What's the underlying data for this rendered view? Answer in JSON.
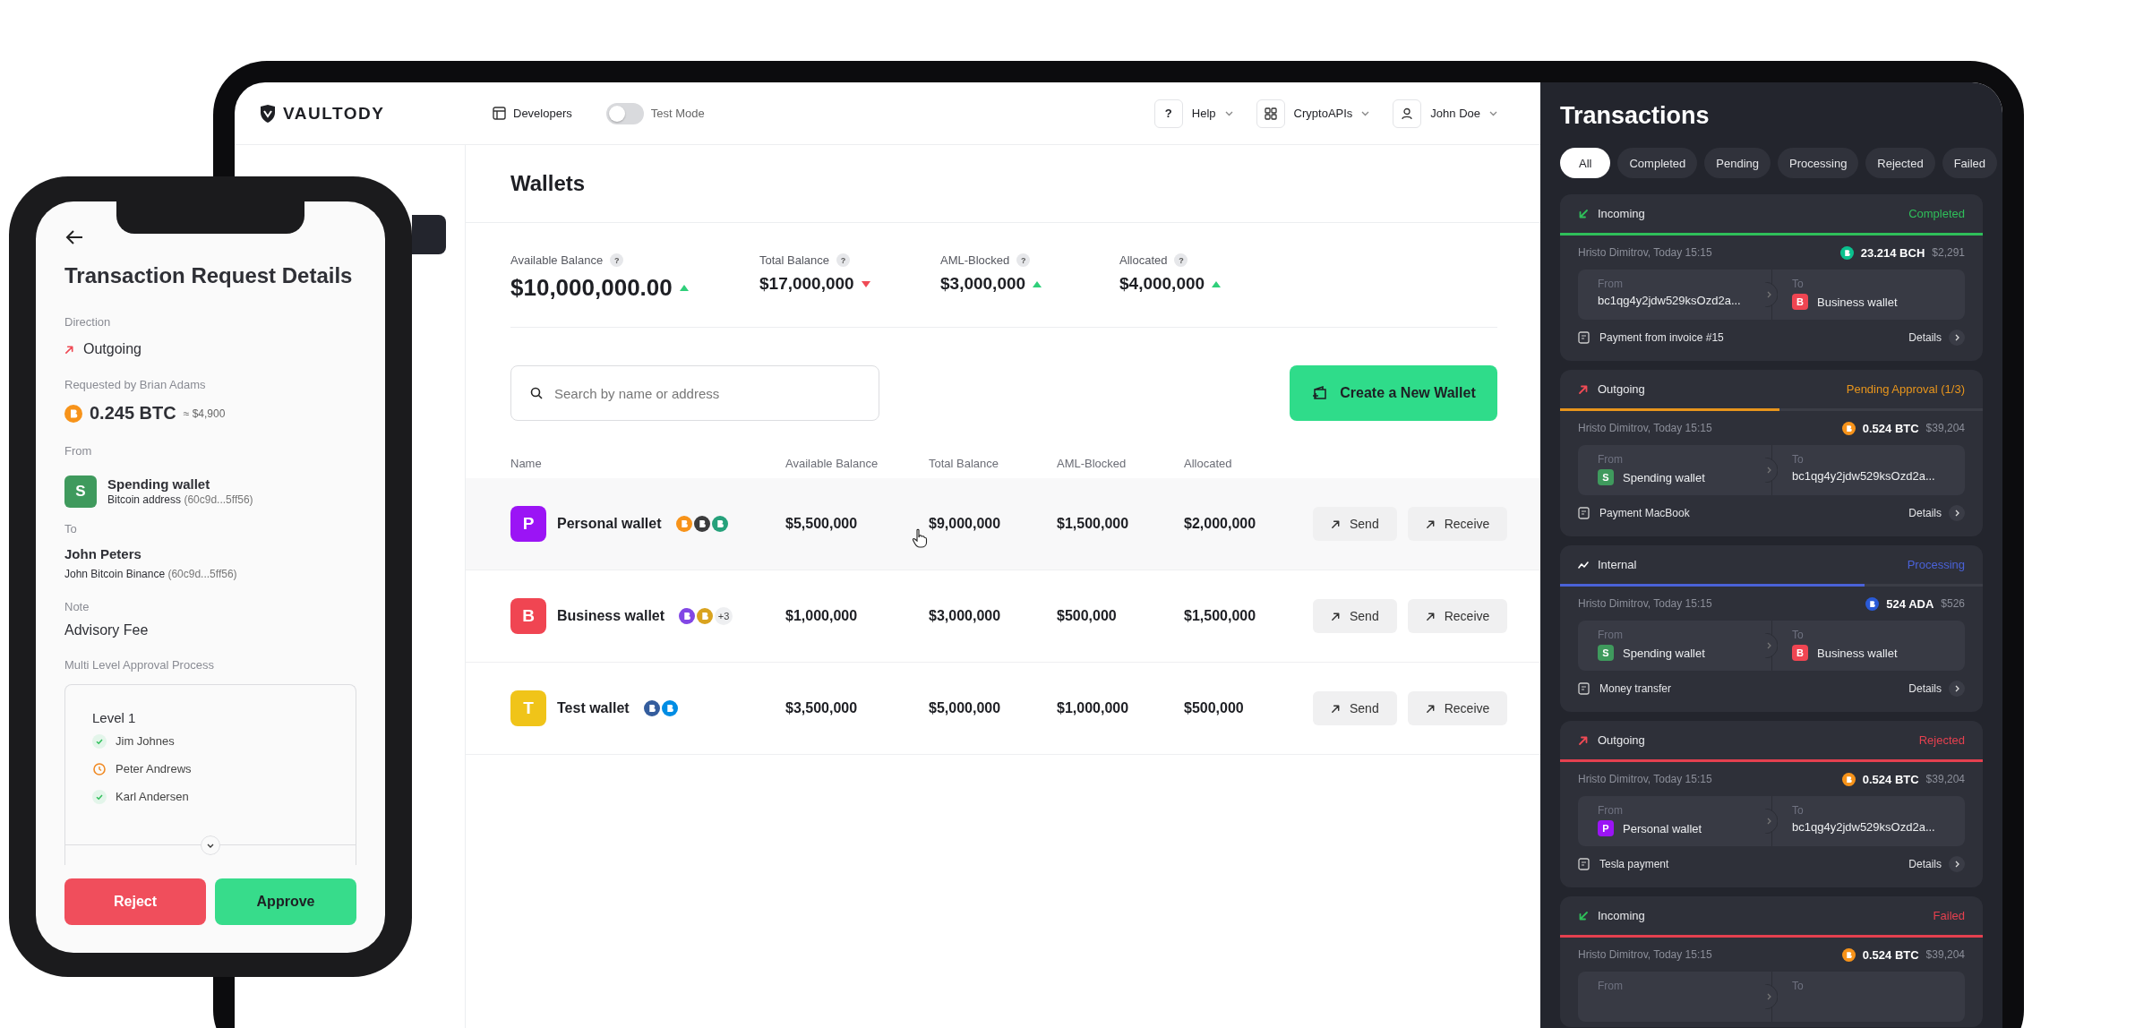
{
  "topbar": {
    "logo": "VAULTODY",
    "developers": "Developers",
    "test_mode": {
      "label": "Test Mode",
      "on": false
    },
    "help": {
      "glyph": "?",
      "label": "Help"
    },
    "apis": {
      "label": "CryptoAPIs"
    },
    "user": {
      "label": "John Doe"
    }
  },
  "sidebar": {
    "items": [
      {
        "selected": true
      }
    ]
  },
  "wallets": {
    "title": "Wallets",
    "balances": [
      {
        "label": "Available Balance",
        "hint": "?",
        "value": "$10,000,000.00",
        "kind": "up"
      },
      {
        "label": "Total Balance",
        "hint": "?",
        "value": "$17,000,000",
        "kind": "down"
      },
      {
        "label": "AML-Blocked",
        "hint": "?",
        "value": "$3,000,000",
        "kind": "up"
      },
      {
        "label": "Allocated",
        "hint": "?",
        "value": "$4,000,000",
        "kind": "up"
      }
    ],
    "search": {
      "placeholder": "Search by name or address"
    },
    "create_button": "Create a New Wallet",
    "columns": [
      "Name",
      "Available Balance",
      "Total Balance",
      "AML-Blocked",
      "Allocated"
    ],
    "rows": [
      {
        "avatar": "P",
        "color": "#9b14f5",
        "name": "Personal wallet",
        "coins": [
          {
            "kind": "btc"
          },
          {
            "kind": "eth"
          },
          {
            "kind": "usdt"
          }
        ],
        "available": "$5,500,000",
        "total": "$9,000,000",
        "aml": "$1,500,000",
        "allocated": "$2,000,000",
        "selected": true,
        "actions": [
          "Send",
          "Receive"
        ]
      },
      {
        "avatar": "B",
        "color": "#f04552",
        "name": "Business wallet",
        "coins": [
          {
            "kind": "matic"
          },
          {
            "kind": "bnb"
          }
        ],
        "more": "+3",
        "available": "$1,000,000",
        "total": "$3,000,000",
        "aml": "$500,000",
        "allocated": "$1,500,000",
        "selected": false,
        "actions": [
          "Send",
          "Receive"
        ]
      },
      {
        "avatar": "T",
        "color": "#f0c419",
        "name": "Test wallet",
        "coins": [
          {
            "kind": "ltc"
          },
          {
            "kind": "dash"
          }
        ],
        "available": "$3,500,000",
        "total": "$5,000,000",
        "aml": "$1,000,000",
        "allocated": "$500,000",
        "selected": false,
        "actions": [
          "Send",
          "Receive"
        ]
      }
    ]
  },
  "transactions": {
    "title": "Transactions",
    "filters": [
      {
        "label": "All",
        "selected": true
      },
      {
        "label": "Completed",
        "selected": false
      },
      {
        "label": "Pending",
        "selected": false
      },
      {
        "label": "Processing",
        "selected": false
      },
      {
        "label": "Rejected",
        "selected": false
      },
      {
        "label": "Failed",
        "selected": false
      }
    ],
    "cards": [
      {
        "kind": "incoming",
        "direction": "Incoming",
        "status": "Completed",
        "color": "#2fbf5a",
        "level": 1,
        "who": "Hristo Dimitrov, Today 15:15",
        "coin": {
          "kind": "bch"
        },
        "amount": "23.214 BCH",
        "usd": "$2,291",
        "from": {
          "label": "From",
          "kind": "address",
          "address": "bc1qg4y2jdw529ksOzd2a..."
        },
        "to": {
          "label": "To",
          "kind": "wallet",
          "avatar": "B",
          "color": "#f04552",
          "name": "Business wallet"
        },
        "note": "Payment from invoice #15",
        "details": "Details"
      },
      {
        "kind": "outgoing",
        "direction": "Outgoing",
        "status": "Pending Approval (1/3)",
        "color": "#e8951c",
        "level": 0.52,
        "who": "Hristo Dimitrov, Today 15:15",
        "coin": {
          "kind": "btc"
        },
        "amount": "0.524 BTC",
        "usd": "$39,204",
        "from": {
          "label": "From",
          "kind": "wallet",
          "avatar": "S",
          "color": "#3f9a5d",
          "name": "Spending wallet"
        },
        "to": {
          "label": "To",
          "kind": "address",
          "address": "bc1qg4y2jdw529ksOzd2a..."
        },
        "note": "Payment MacBook",
        "details": "Details"
      },
      {
        "kind": "internal",
        "direction": "Internal",
        "status": "Processing",
        "color": "#4a62d8",
        "level": 0.72,
        "who": "Hristo Dimitrov, Today 15:15",
        "coin": {
          "kind": "ada"
        },
        "amount": "524 ADA",
        "usd": "$526",
        "from": {
          "label": "From",
          "kind": "wallet",
          "avatar": "S",
          "color": "#3f9a5d",
          "name": "Spending wallet"
        },
        "to": {
          "label": "To",
          "kind": "wallet",
          "avatar": "B",
          "color": "#f04552",
          "name": "Business wallet"
        },
        "note": "Money transfer",
        "details": "Details"
      },
      {
        "kind": "outgoing",
        "direction": "Outgoing",
        "status": "Rejected",
        "color": "#e5404f",
        "level": 1,
        "who": "Hristo Dimitrov, Today 15:15",
        "coin": {
          "kind": "btc"
        },
        "amount": "0.524 BTC",
        "usd": "$39,204",
        "from": {
          "label": "From",
          "kind": "wallet",
          "avatar": "P",
          "color": "#9b14f5",
          "name": "Personal wallet"
        },
        "to": {
          "label": "To",
          "kind": "address",
          "address": "bc1qg4y2jdw529ksOzd2a..."
        },
        "note": "Tesla payment",
        "details": "Details"
      },
      {
        "kind": "incoming",
        "direction": "Incoming",
        "status": "Failed",
        "color": "#e5404f",
        "level": 1,
        "who": "Hristo Dimitrov, Today 15:15",
        "coin": {
          "kind": "btc"
        },
        "amount": "0.524 BTC",
        "usd": "$39,204",
        "from": {
          "label": "From"
        },
        "to": {
          "label": "To"
        }
      }
    ]
  },
  "phone": {
    "title": "Transaction Request Details",
    "direction_label": "Direction",
    "direction": {
      "kind": "outgoing",
      "label": "Outgoing"
    },
    "requested_by": "Requested by Brian Adams",
    "coin": {
      "kind": "btc"
    },
    "amount": "0.245 BTC",
    "amount_usd": "≈ $4,900",
    "from_label": "From",
    "from": {
      "avatar": "S",
      "color": "#3f9a5d",
      "name": "Spending wallet",
      "detail": "Bitcoin address",
      "address": "(60c9d...5ff56)"
    },
    "to_label": "To",
    "to": {
      "name": "John Peters",
      "detail": "John Bitcoin Binance",
      "address": "(60c9d...5ff56)"
    },
    "note_label": "Note",
    "note": "Advisory Fee",
    "approval_label": "Multi Level Approval Process",
    "approval": {
      "title": "Level 1",
      "approvers": [
        {
          "name": "Jim Johnes",
          "kind": "approved"
        },
        {
          "name": "Peter Andrews",
          "kind": "pending"
        },
        {
          "name": "Karl Andersen",
          "kind": "approved"
        }
      ]
    },
    "buttons": [
      {
        "label": "Reject",
        "kind": "reject"
      },
      {
        "label": "Approve",
        "kind": "approve"
      }
    ]
  }
}
